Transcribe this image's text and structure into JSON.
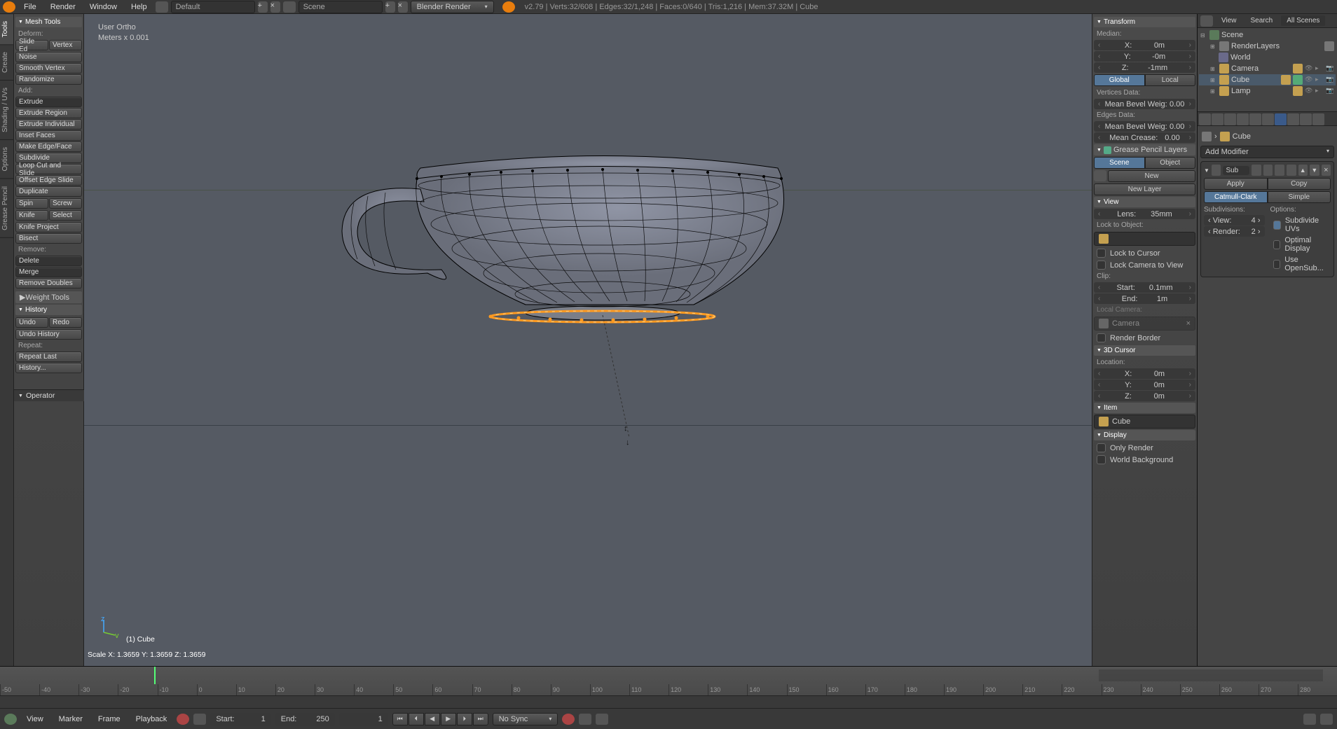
{
  "topbar": {
    "menus": [
      "File",
      "Render",
      "Window",
      "Help"
    ],
    "layout": "Default",
    "scene": "Scene",
    "engine": "Blender Render",
    "stats": "v2.79 | Verts:32/608 | Edges:32/1,248 | Faces:0/640 | Tris:1,216 | Mem:37.32M | Cube"
  },
  "left_tabs": [
    "Tools",
    "Create",
    "Shading / UVs",
    "Options",
    "Grease Pencil"
  ],
  "tool_panel": {
    "mesh_tools": "Mesh Tools",
    "deform": "Deform:",
    "slide_edge": "Slide Ed",
    "vertex": "Vertex",
    "noise": "Noise",
    "smooth_vertex": "Smooth Vertex",
    "randomize": "Randomize",
    "add": "Add:",
    "extrude": "Extrude",
    "extrude_region": "Extrude Region",
    "extrude_individual": "Extrude Individual",
    "inset_faces": "Inset Faces",
    "make_edge_face": "Make Edge/Face",
    "subdivide": "Subdivide",
    "loop_cut": "Loop Cut and Slide",
    "offset_edge": "Offset Edge Slide",
    "duplicate": "Duplicate",
    "spin": "Spin",
    "screw": "Screw",
    "knife": "Knife",
    "select": "Select",
    "knife_project": "Knife Project",
    "bisect": "Bisect",
    "remove": "Remove:",
    "delete": "Delete",
    "merge": "Merge",
    "remove_doubles": "Remove Doubles",
    "weight_tools": "Weight Tools",
    "history": "History",
    "undo": "Undo",
    "redo": "Redo",
    "undo_history": "Undo History",
    "repeat": "Repeat:",
    "repeat_last": "Repeat Last",
    "history_menu": "History...",
    "operator": "Operator"
  },
  "viewport": {
    "info1": "User Ortho",
    "info2": "Meters x 0.001",
    "object_label": "(1) Cube",
    "status": "Scale X: 1.3659   Y: 1.3659   Z: 1.3659"
  },
  "n_panel": {
    "transform": "Transform",
    "median": "Median:",
    "x_label": "X:",
    "x_val": "0m",
    "y_label": "Y:",
    "y_val": "-0m",
    "z_label": "Z:",
    "z_val": "-1mm",
    "global": "Global",
    "local": "Local",
    "vertices_data": "Vertices Data:",
    "mean_bevel": "Mean Bevel Weig:",
    "mbw_val": "0.00",
    "edges_data": "Edges Data:",
    "mean_bevel2": "Mean Bevel Weig:",
    "mbw2_val": "0.00",
    "mean_crease": "Mean Crease:",
    "mc_val": "0.00",
    "grease": "Grease Pencil Layers",
    "scene": "Scene",
    "object": "Object",
    "new": "New",
    "new_layer": "New Layer",
    "view": "View",
    "lens": "Lens:",
    "lens_val": "35mm",
    "lock_obj": "Lock to Object:",
    "lock_cursor": "Lock to Cursor",
    "lock_camera": "Lock Camera to View",
    "clip": "Clip:",
    "clip_start": "Start:",
    "cs_val": "0.1mm",
    "clip_end": "End:",
    "ce_val": "1m",
    "local_camera": "Local Camera:",
    "camera": "Camera",
    "render_border": "Render Border",
    "cursor_3d": "3D Cursor",
    "location": "Location:",
    "cx": "X:",
    "cx_val": "0m",
    "cy": "Y:",
    "cy_val": "0m",
    "cz": "Z:",
    "cz_val": "0m",
    "item": "Item",
    "item_name": "Cube",
    "display": "Display",
    "only_render": "Only Render",
    "world_bg": "World Background"
  },
  "outliner": {
    "view": "View",
    "search": "Search",
    "all_scenes": "All Scenes",
    "scene": "Scene",
    "render_layers": "RenderLayers",
    "world": "World",
    "camera": "Camera",
    "cube": "Cube",
    "lamp": "Lamp"
  },
  "properties": {
    "breadcrumb_obj": "Cube",
    "add_modifier": "Add Modifier",
    "mod_name": "Sub",
    "apply": "Apply",
    "copy": "Copy",
    "catmull": "Catmull-Clark",
    "simple": "Simple",
    "subdivisions": "Subdivisions:",
    "options": "Options:",
    "view": "View:",
    "view_val": "4",
    "render": "Render:",
    "render_val": "2",
    "subdivide_uvs": "Subdivide UVs",
    "optimal_display": "Optimal Display",
    "use_opensub": "Use OpenSub..."
  },
  "timeline": {
    "ticks": [
      "-50",
      "-40",
      "-30",
      "-20",
      "-10",
      "0",
      "10",
      "20",
      "30",
      "40",
      "50",
      "60",
      "70",
      "80",
      "90",
      "100",
      "110",
      "120",
      "130",
      "140",
      "150",
      "160",
      "170",
      "180",
      "190",
      "200",
      "210",
      "220",
      "230",
      "240",
      "250",
      "260",
      "270",
      "280"
    ],
    "start_lbl": "Start:",
    "start_val": "1",
    "end_lbl": "End:",
    "end_val": "250",
    "frame_val": "1",
    "no_sync": "No Sync",
    "view": "View",
    "marker": "Marker",
    "frame": "Frame",
    "playback": "Playback"
  }
}
